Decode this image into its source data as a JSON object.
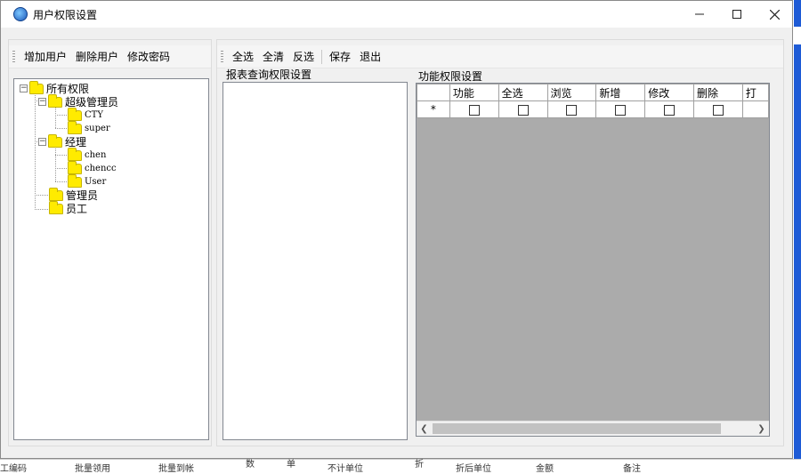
{
  "window": {
    "title": "用户权限设置",
    "icon": "app-globe-icon",
    "controls": {
      "minimize": "minimize-icon",
      "maximize": "maximize-icon",
      "close": "close-icon"
    }
  },
  "left_toolbar": {
    "add_user": "增加用户",
    "delete_user": "删除用户",
    "change_password": "修改密码"
  },
  "right_toolbar": {
    "select_all": "全选",
    "clear_all": "全清",
    "invert": "反选",
    "save": "保存",
    "exit": "退出"
  },
  "tree": {
    "root": "所有权限",
    "nodes": [
      {
        "label": "超级管理员",
        "children": [
          "CTY",
          "super"
        ]
      },
      {
        "label": "经理",
        "children": [
          "chen",
          "chencc",
          "User"
        ]
      },
      {
        "label": "管理员"
      },
      {
        "label": "员工"
      }
    ]
  },
  "report_group": {
    "label": "报表查询权限设置"
  },
  "function_group": {
    "label": "功能权限设置",
    "columns": [
      "功能",
      "全选",
      "浏览",
      "新增",
      "修改",
      "删除",
      "打"
    ],
    "new_row_marker": "*"
  },
  "background_strip": [
    "工编码",
    "批量领用",
    "批量到帐",
    "数",
    "单",
    "不计单位",
    "折",
    "折后单位",
    "金额",
    "备注"
  ],
  "colors": {
    "window_bg": "#f0f0f0",
    "grid_empty_bg": "#ababab",
    "folder": "#ffeb00",
    "accent_blue": "#1e5bd6"
  }
}
